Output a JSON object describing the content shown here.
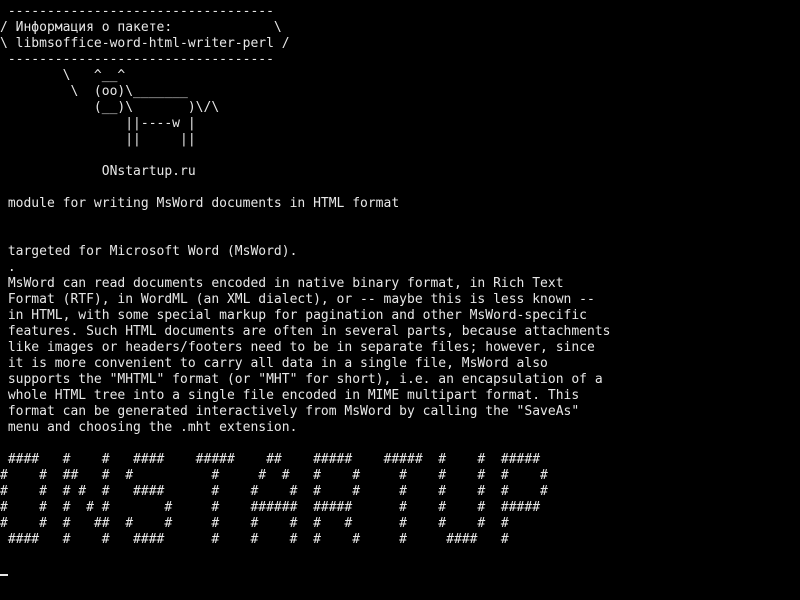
{
  "terminal": {
    "banner": [
      " ----------------------------------",
      "/ Информация о пакете:             \\",
      "\\ libmsoffice-word-html-writer-perl /",
      " ----------------------------------",
      "        \\   ^__^",
      "         \\  (oo)\\_______",
      "            (__)\\       )\\/\\",
      "                ||----w |",
      "                ||     ||",
      "",
      "             ONstartup.ru"
    ],
    "summary": " module for writing MsWord documents in HTML format",
    "description": [
      " targeted for Microsoft Word (MsWord).",
      " .",
      " MsWord can read documents encoded in native binary format, in Rich Text",
      " Format (RTF), in WordML (an XML dialect), or -- maybe this is less known --",
      " in HTML, with some special markup for pagination and other MsWord-specific",
      " features. Such HTML documents are often in several parts, because attachments",
      " like images or headers/footers need to be in separate files; however, since",
      " it is more convenient to carry all data in a single file, MsWord also",
      " supports the \"MHTML\" format (or \"MHT\" for short), i.e. an encapsulation of a",
      " whole HTML tree into a single file encoded in MIME multipart format. This",
      " format can be generated interactively from MsWord by calling the \"SaveAs\"",
      " menu and choosing the .mht extension."
    ],
    "ascii_art": [
      " ####   #    #   ####    #####    ##    #####    #####  #    #  #####",
      "#    #  ##   #  #          #     #  #   #    #     #    #    #  #    #",
      "#    #  # #  #   ####      #    #    #  #    #     #    #    #  #    #",
      "#    #  #  # #       #     #    ######  #####      #    #    #  #####",
      "#    #  #   ##  #    #     #    #    #  #   #      #    #    #  #",
      " ####   #    #   ####      #    #    #  #    #     #     ####   #"
    ]
  }
}
